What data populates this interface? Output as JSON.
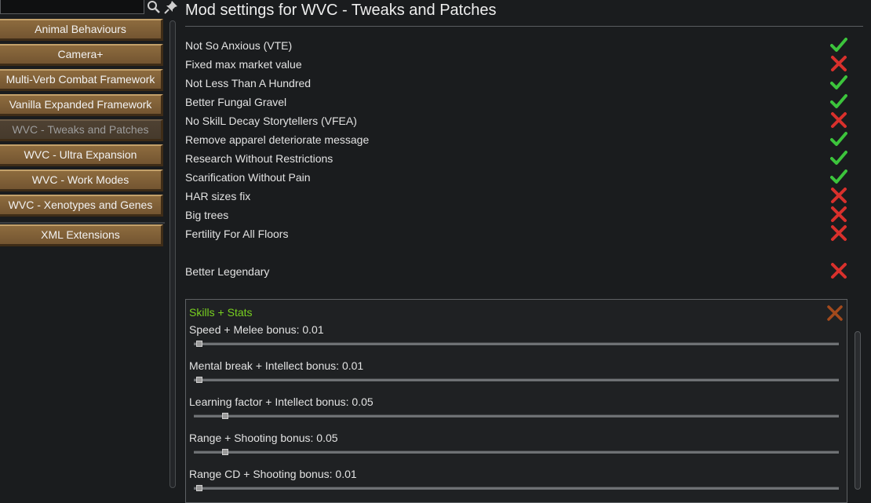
{
  "sidebar": {
    "search": {
      "value": "",
      "placeholder": ""
    },
    "mods": [
      {
        "label": "Animal Behaviours"
      },
      {
        "label": "Camera+"
      },
      {
        "label": "Multi-Verb Combat Framework"
      },
      {
        "label": "Vanilla Expanded Framework"
      },
      {
        "label": "WVC - Tweaks and Patches",
        "active": true
      },
      {
        "label": "WVC - Ultra Expansion"
      },
      {
        "label": "WVC - Work Modes"
      },
      {
        "label": "WVC - Xenotypes and Genes"
      },
      {
        "label": "XML Extensions"
      }
    ]
  },
  "main": {
    "title": "Mod settings for WVC - Tweaks and Patches",
    "settings": [
      {
        "label": "Not So Anxious (VTE)",
        "enabled": true
      },
      {
        "label": "Fixed max market value",
        "enabled": false
      },
      {
        "label": "Not Less Than A Hundred",
        "enabled": true
      },
      {
        "label": "Better Fungal Gravel",
        "enabled": true
      },
      {
        "label": "No SkilL Decay Storytellers (VFEA)",
        "enabled": false
      },
      {
        "label": "Remove apparel deteriorate message",
        "enabled": true
      },
      {
        "label": "Research Without Restrictions",
        "enabled": true
      },
      {
        "label": "Scarification Without Pain",
        "enabled": true
      },
      {
        "label": "HAR sizes fix",
        "enabled": false
      },
      {
        "label": "Big trees",
        "enabled": false
      },
      {
        "label": "Fertility For All Floors",
        "enabled": false
      },
      {
        "label": "Better Legendary",
        "enabled": false
      }
    ],
    "group": {
      "title": "Skills + Stats",
      "sliders": [
        {
          "label": "Speed + Melee bonus: 0.01",
          "value": 0.01
        },
        {
          "label": "Mental break + Intellect bonus: 0.01",
          "value": 0.01
        },
        {
          "label": "Learning factor + Intellect bonus: 0.05",
          "value": 0.05
        },
        {
          "label": "Range + Shooting bonus: 0.05",
          "value": 0.05
        },
        {
          "label": "Range CD + Shooting bonus: 0.01",
          "value": 0.01
        }
      ]
    }
  },
  "colors": {
    "check": "#3cc43c",
    "cross": "#d9302c",
    "group_title": "#78d020",
    "group_close": "#a34a1c"
  },
  "icons": {
    "search": "search-icon",
    "pin": "pin-icon",
    "check": "checkmark-icon",
    "cross": "cross-icon"
  }
}
